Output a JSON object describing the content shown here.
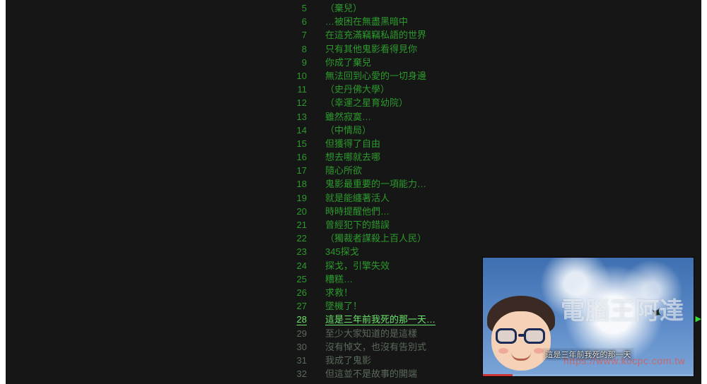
{
  "active_index": 23,
  "lines": [
    {
      "n": 5,
      "t": "（棄兒）"
    },
    {
      "n": 6,
      "t": "…被困在無盡黑暗中"
    },
    {
      "n": 7,
      "t": "在這充滿竊竊私語的世界"
    },
    {
      "n": 8,
      "t": "只有其他鬼影看得見你"
    },
    {
      "n": 9,
      "t": "你成了棄兒"
    },
    {
      "n": 10,
      "t": "無法回到心愛的一切身邊"
    },
    {
      "n": 11,
      "t": "（史丹佛大學）"
    },
    {
      "n": 12,
      "t": "（幸運之星育幼院）"
    },
    {
      "n": 13,
      "t": "雖然寂寞…"
    },
    {
      "n": 14,
      "t": "（中情局）"
    },
    {
      "n": 15,
      "t": "但獲得了自由"
    },
    {
      "n": 16,
      "t": "想去哪就去哪"
    },
    {
      "n": 17,
      "t": "隨心所欲"
    },
    {
      "n": 18,
      "t": "鬼影最重要的一項能力…"
    },
    {
      "n": 19,
      "t": "就是能纏著活人"
    },
    {
      "n": 20,
      "t": "時時提醒他們…"
    },
    {
      "n": 21,
      "t": "曾經犯下的錯誤"
    },
    {
      "n": 22,
      "t": "（獨裁者謀殺上百人民）"
    },
    {
      "n": 23,
      "t": "345探戈"
    },
    {
      "n": 24,
      "t": "探戈，引擎失效"
    },
    {
      "n": 25,
      "t": "糟糕…"
    },
    {
      "n": 26,
      "t": "求救！"
    },
    {
      "n": 27,
      "t": "墜機了！"
    },
    {
      "n": 28,
      "t": "這是三年前我死的那一天…"
    },
    {
      "n": 29,
      "t": "至少大家知道的是這樣"
    },
    {
      "n": 30,
      "t": "沒有悼文，也沒有告別式"
    },
    {
      "n": 31,
      "t": "我成了鬼影"
    },
    {
      "n": 32,
      "t": "但這並不是故事的開端"
    }
  ],
  "thumbnail": {
    "caption": "這是三年前我死的那一天",
    "watermark_text": "電腦王阿達",
    "watermark_url": "https://www.kocpc.com.tw"
  }
}
